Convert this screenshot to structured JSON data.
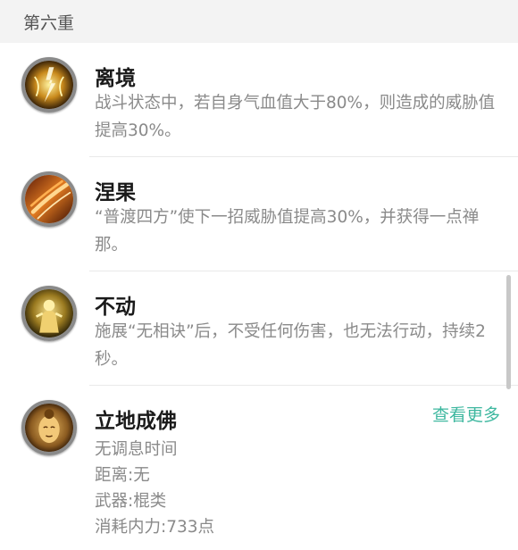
{
  "section": {
    "title": "第六重"
  },
  "skills": [
    {
      "name": "离境",
      "desc": "战斗状态中，若自身气血值大于80%，则造成的威胁值提高30%。",
      "icon": "lightning-figure-icon"
    },
    {
      "name": "涅果",
      "desc": "“普渡四方”使下一招威胁值提高30%，并获得一点禅那。",
      "icon": "flame-slash-icon"
    },
    {
      "name": "不动",
      "desc": "施展“无相诀”后，不受任何伤害，也无法行动，持续2秒。",
      "icon": "golden-statue-icon"
    },
    {
      "name": "立地成佛",
      "icon": "buddha-face-icon",
      "more_label": "查看更多",
      "details": [
        "无调息时间",
        "距离:无",
        "武器:棍类",
        "消耗内力:733点"
      ]
    }
  ],
  "colors": {
    "accent": "#3fb8a0",
    "muted_text": "#8a8a8a",
    "header_bg": "#f3f3f3"
  }
}
